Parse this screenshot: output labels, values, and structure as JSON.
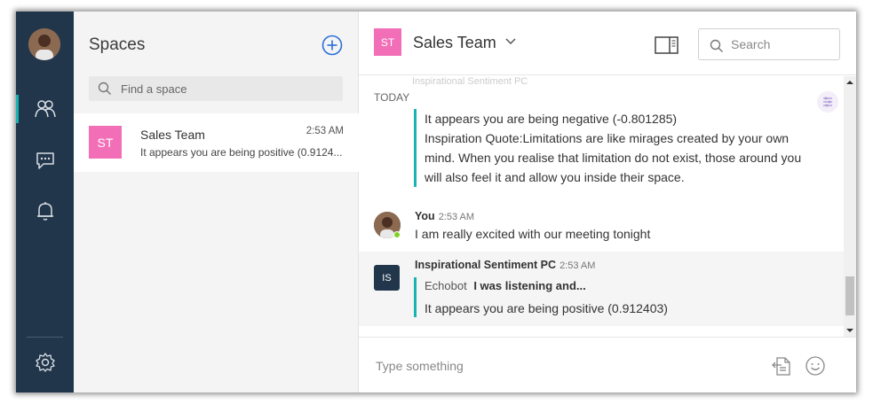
{
  "rail": {
    "nav": [
      "spaces",
      "messages",
      "notifications"
    ],
    "settings": "settings"
  },
  "spaces": {
    "title": "Spaces",
    "find_placeholder": "Find a space",
    "items": [
      {
        "initials": "ST",
        "name": "Sales Team",
        "time": "2:53 AM",
        "preview": "It appears you are being positive (0.9124...",
        "badge_color": "#f26fb8"
      }
    ]
  },
  "chat": {
    "initials": "ST",
    "title": "Sales Team",
    "search_placeholder": "Search",
    "today_label": "TODAY",
    "faded_text": "Inspirational Sentiment PC",
    "messages": [
      {
        "quote_lines": [
          "It appears you are being negative (-0.801285)",
          "Inspiration Quote:Limitations are like mirages created by your own",
          "mind. When you realise that limitation do not exist, those around you",
          "will also feel it and allow you inside their space."
        ]
      },
      {
        "sender": "You",
        "time": "2:53 AM",
        "text": "I am really excited with our meeting tonight"
      },
      {
        "initials": "IS",
        "sender": "Inspirational Sentiment PC",
        "time": "2:53 AM",
        "quoted_author": "Echobot",
        "quoted_text": "I was listening and...",
        "text": "It appears you are being positive (0.912403)"
      }
    ],
    "composer_placeholder": "Type something"
  },
  "colors": {
    "rail": "#22364b",
    "accent": "#1ab3b3",
    "badge": "#f26fb8",
    "online": "#7ed321"
  }
}
